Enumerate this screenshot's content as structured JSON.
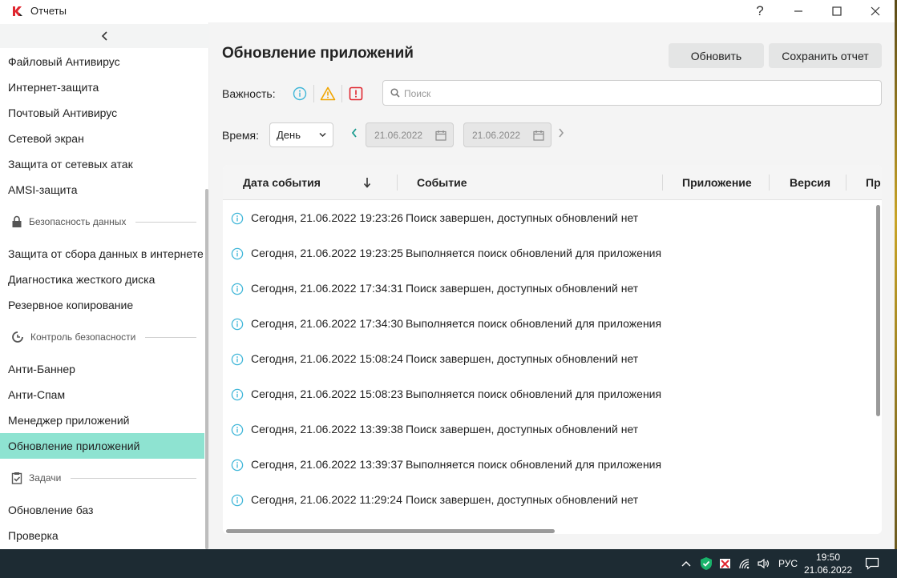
{
  "window": {
    "title": "Отчеты",
    "help_glyph": "?"
  },
  "sidebar": {
    "items_top": [
      {
        "label": "Файловый Антивирус"
      },
      {
        "label": "Интернет-защита"
      },
      {
        "label": "Почтовый Антивирус"
      },
      {
        "label": "Сетевой экран"
      },
      {
        "label": "Защита от сетевых атак"
      },
      {
        "label": "AMSI-защита"
      }
    ],
    "section_data": {
      "label": "Безопасность данных",
      "icon": "lock-icon"
    },
    "items_data": [
      {
        "label": "Защита от сбора данных в интернете"
      },
      {
        "label": "Диагностика жесткого диска"
      },
      {
        "label": "Резервное копирование"
      }
    ],
    "section_control": {
      "label": "Контроль безопасности",
      "icon": "control-icon"
    },
    "items_control": [
      {
        "label": "Анти-Баннер"
      },
      {
        "label": "Анти-Спам"
      },
      {
        "label": "Менеджер приложений"
      },
      {
        "label": "Обновление приложений",
        "active": true
      }
    ],
    "section_tasks": {
      "label": "Задачи",
      "icon": "clipboard-check-icon"
    },
    "items_tasks": [
      {
        "label": "Обновление баз"
      },
      {
        "label": "Проверка"
      }
    ]
  },
  "main": {
    "title": "Обновление приложений",
    "refresh_label": "Обновить",
    "save_label": "Сохранить отчет",
    "severity_label": "Важность:",
    "severity_levels": [
      "info-icon",
      "warning-icon",
      "critical-icon"
    ],
    "search_placeholder": "Поиск",
    "time_label": "Время:",
    "period": "День",
    "date_from": "21.06.2022",
    "date_to": "21.06.2022"
  },
  "table": {
    "columns": [
      {
        "label": "Дата события",
        "sorted": "desc"
      },
      {
        "label": "Событие"
      },
      {
        "label": "Приложение"
      },
      {
        "label": "Версия"
      },
      {
        "label": "Пр"
      }
    ],
    "rows": [
      {
        "date": "Сегодня, 21.06.2022 19:23:26",
        "event": "Поиск завершен, доступных обновлений нет"
      },
      {
        "date": "Сегодня, 21.06.2022 19:23:25",
        "event": "Выполняется поиск обновлений для приложения"
      },
      {
        "date": "Сегодня, 21.06.2022 17:34:31",
        "event": "Поиск завершен, доступных обновлений нет"
      },
      {
        "date": "Сегодня, 21.06.2022 17:34:30",
        "event": "Выполняется поиск обновлений для приложения"
      },
      {
        "date": "Сегодня, 21.06.2022 15:08:24",
        "event": "Поиск завершен, доступных обновлений нет"
      },
      {
        "date": "Сегодня, 21.06.2022 15:08:23",
        "event": "Выполняется поиск обновлений для приложения"
      },
      {
        "date": "Сегодня, 21.06.2022 13:39:38",
        "event": "Поиск завершен, доступных обновлений нет"
      },
      {
        "date": "Сегодня, 21.06.2022 13:39:37",
        "event": "Выполняется поиск обновлений для приложения"
      },
      {
        "date": "Сегодня, 21.06.2022 11:29:24",
        "event": "Поиск завершен, доступных обновлений нет"
      }
    ]
  },
  "taskbar": {
    "language": "РУС",
    "time": "19:50",
    "date": "21.06.2022"
  },
  "colors": {
    "accent_active": "#8ee3d1",
    "info": "#3fb6d8",
    "warning": "#f0a500",
    "critical": "#e0262f",
    "brand": "#e0262f"
  }
}
